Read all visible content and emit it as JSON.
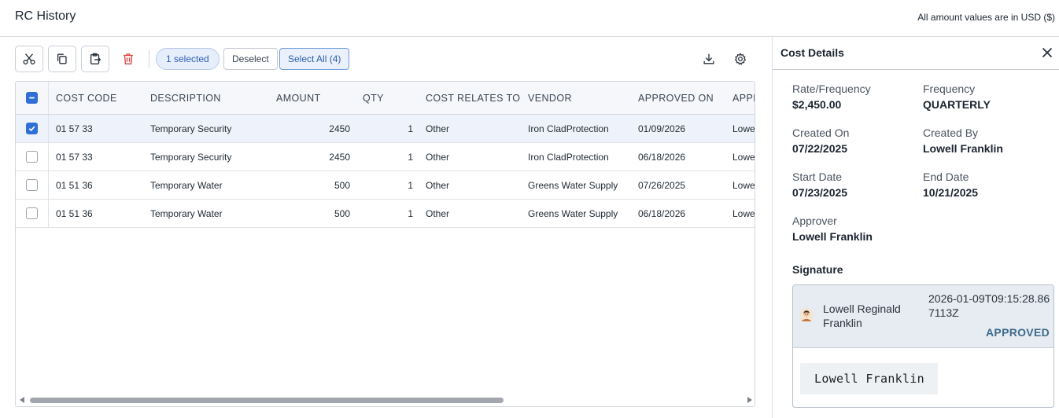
{
  "page": {
    "title": "RC History",
    "currency_note": "All amount values are in USD ($)"
  },
  "toolbar": {
    "cut_icon": "scissors-icon",
    "copy_icon": "copy-icon",
    "paste_icon": "paste-icon",
    "delete_icon": "trash-icon",
    "selected_label": "1 selected",
    "deselect_label": "Deselect",
    "select_all_label": "Select All (4)",
    "download_icon": "download-icon",
    "settings_icon": "gear-icon"
  },
  "grid": {
    "columns": [
      "COST CODE",
      "DESCRIPTION",
      "AMOUNT",
      "QTY",
      "COST RELATES TO",
      "VENDOR",
      "APPROVED ON",
      "APPR"
    ],
    "rows": [
      {
        "selected": true,
        "cost_code": "01 57 33",
        "description": "Temporary Security",
        "amount": "2450",
        "qty": "1",
        "relates_to": "Other",
        "vendor": "Iron CladProtection",
        "approved_on": "01/09/2026",
        "approver": "Lowe"
      },
      {
        "selected": false,
        "cost_code": "01 57 33",
        "description": "Temporary Security",
        "amount": "2450",
        "qty": "1",
        "relates_to": "Other",
        "vendor": "Iron CladProtection",
        "approved_on": "06/18/2026",
        "approver": "Lowe"
      },
      {
        "selected": false,
        "cost_code": "01 51 36",
        "description": "Temporary Water",
        "amount": "500",
        "qty": "1",
        "relates_to": "Other",
        "vendor": "Greens Water Supply",
        "approved_on": "07/26/2025",
        "approver": "Lowe"
      },
      {
        "selected": false,
        "cost_code": "01 51 36",
        "description": "Temporary Water",
        "amount": "500",
        "qty": "1",
        "relates_to": "Other",
        "vendor": "Greens Water Supply",
        "approved_on": "06/18/2026",
        "approver": "Lowe"
      }
    ]
  },
  "details": {
    "title": "Cost Details",
    "rate_label": "Rate/Frequency",
    "rate_value": "$2,450.00",
    "frequency_label": "Frequency",
    "frequency_value": "QUARTERLY",
    "created_on_label": "Created On",
    "created_on_value": "07/22/2025",
    "created_by_label": "Created By",
    "created_by_value": "Lowell Franklin",
    "start_label": "Start Date",
    "start_value": "07/23/2025",
    "end_label": "End Date",
    "end_value": "10/21/2025",
    "approver_label": "Approver",
    "approver_value": "Lowell Franklin"
  },
  "signature": {
    "heading": "Signature",
    "name": "Lowell Reginald Franklin",
    "timestamp": "2026-01-09T09:15:28.867113Z",
    "status": "APPROVED",
    "signed_name": "Lowell Franklin"
  },
  "colors": {
    "accent": "#2f6fd6",
    "status": "#3d6a8a",
    "delete": "#d64545"
  }
}
